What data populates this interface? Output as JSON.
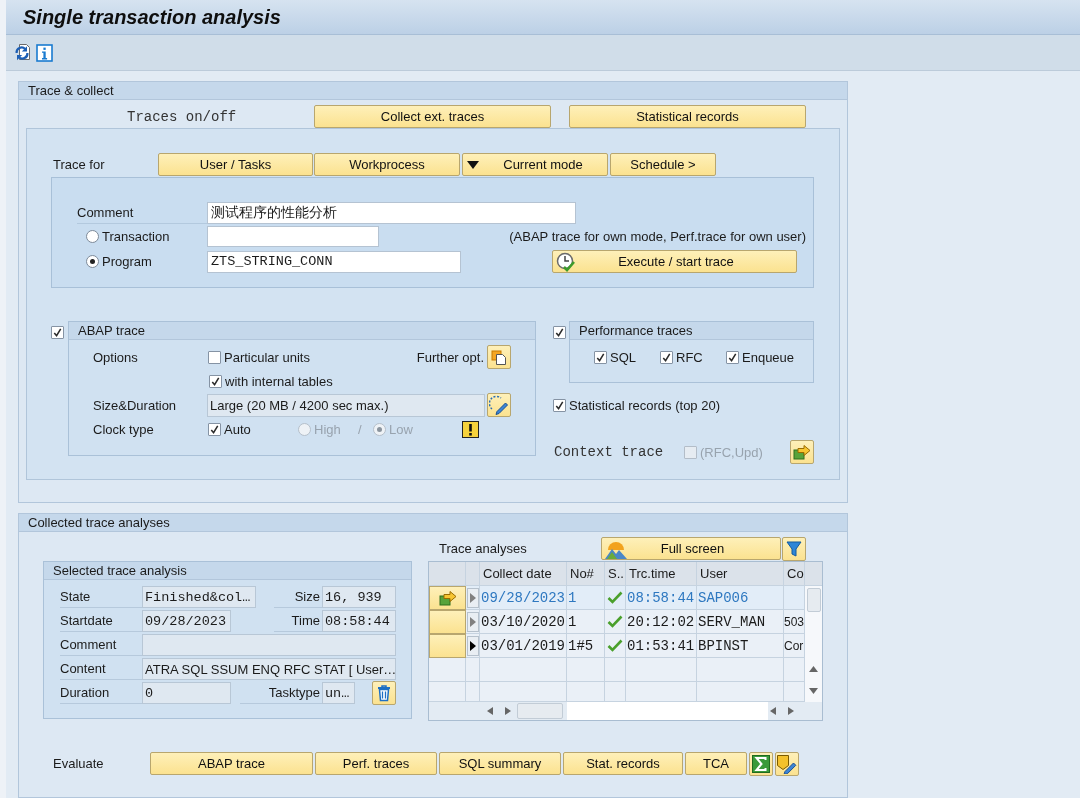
{
  "window": {
    "title": "Single transaction analysis"
  },
  "trace_collect": {
    "title": "Trace & collect",
    "traces_label": "Traces on/off",
    "switch_buttons": [
      "Collect ext. traces",
      "Statistical records"
    ],
    "trace_for": {
      "label": "Trace for",
      "buttons": [
        {
          "label": "User / Tasks",
          "kind": "plain"
        },
        {
          "label": "Workprocess",
          "kind": "plain"
        },
        {
          "label": "Current mode",
          "kind": "dropdown"
        },
        {
          "label": "Schedule >",
          "kind": "plain"
        }
      ]
    },
    "comment": {
      "label": "Comment",
      "value": "测试程序的性能分析"
    },
    "targets": [
      {
        "label": "Transaction",
        "selected": false
      },
      {
        "label": "Program",
        "selected": true,
        "value": "ZTS_STRING_CONN"
      }
    ],
    "hint": "(ABAP trace for own mode, Perf.trace for own user)",
    "execute_button": "Execute / start trace",
    "abap_trace": {
      "title": "ABAP trace",
      "checked": true,
      "options_label": "Options",
      "options": [
        {
          "label": "Particular units",
          "checked": false
        },
        {
          "label": "with internal tables",
          "checked": true
        }
      ],
      "further_label": "Further opt.",
      "size_label": "Size&Duration",
      "size_value": "Large (20 MB / 4200 sec max.)",
      "clock_label": "Clock type",
      "clock_auto": {
        "label": "Auto",
        "checked": true
      },
      "clock_modes": [
        {
          "label": "High",
          "selected": false,
          "disabled": true
        },
        {
          "label": "Low",
          "selected": true,
          "disabled": true
        }
      ],
      "clock_separator": "/"
    },
    "performance_traces": {
      "title": "Performance traces",
      "checked": true,
      "items": [
        {
          "label": "SQL",
          "checked": true
        },
        {
          "label": "RFC",
          "checked": true
        },
        {
          "label": "Enqueue",
          "checked": true
        }
      ]
    },
    "statistical_records": {
      "label": "Statistical records (top 20)",
      "checked": true
    },
    "context_trace": {
      "label": "Context trace",
      "option": {
        "label": "(RFC,Upd)",
        "checked": false,
        "disabled": true
      }
    }
  },
  "collected": {
    "title": "Collected trace analyses",
    "selected_analysis": {
      "title": "Selected trace analysis",
      "rows": [
        {
          "fields": [
            {
              "label": "State",
              "value": "Finished&col…"
            },
            {
              "label": "Size",
              "value": "16, 939"
            }
          ]
        },
        {
          "fields": [
            {
              "label": "Startdate",
              "value": "09/28/2023"
            },
            {
              "label": "Time",
              "value": "08:58:44"
            }
          ]
        },
        {
          "fields": [
            {
              "label": "Comment"
            }
          ]
        },
        {
          "fields": [
            {
              "label": "Content",
              "value": "ATRA SQL SSUM ENQ RFC STAT [ User…"
            }
          ]
        },
        {
          "fields": [
            {
              "label": "Duration",
              "value": "0"
            },
            {
              "label": "Tasktype",
              "value": "un…"
            }
          ]
        }
      ]
    },
    "trace_analyses": {
      "title": "Trace analyses",
      "full_screen_button": "Full screen",
      "columns": [
        "Collect date",
        "No#",
        "S..",
        "Trc.time",
        "User",
        "Co"
      ],
      "rows": [
        {
          "selected": true,
          "current": false,
          "collect_date": "09/28/2023",
          "no": "1",
          "trc_time": "08:58:44",
          "user": "SAP006"
        },
        {
          "selected": false,
          "current": false,
          "collect_date": "03/10/2020",
          "no": "1",
          "trc_time": "20:12:02",
          "user": "SERV_MAN",
          "column_6": "503"
        },
        {
          "selected": false,
          "current": true,
          "collect_date": "03/01/2019",
          "no": "1#5",
          "trc_time": "01:53:41",
          "user": "BPINST",
          "column_6": "Cor"
        }
      ]
    }
  },
  "evaluate": {
    "label": "Evaluate",
    "buttons": [
      "ABAP trace",
      "Perf. traces",
      "SQL summary",
      "Stat. records",
      "TCA"
    ]
  }
}
